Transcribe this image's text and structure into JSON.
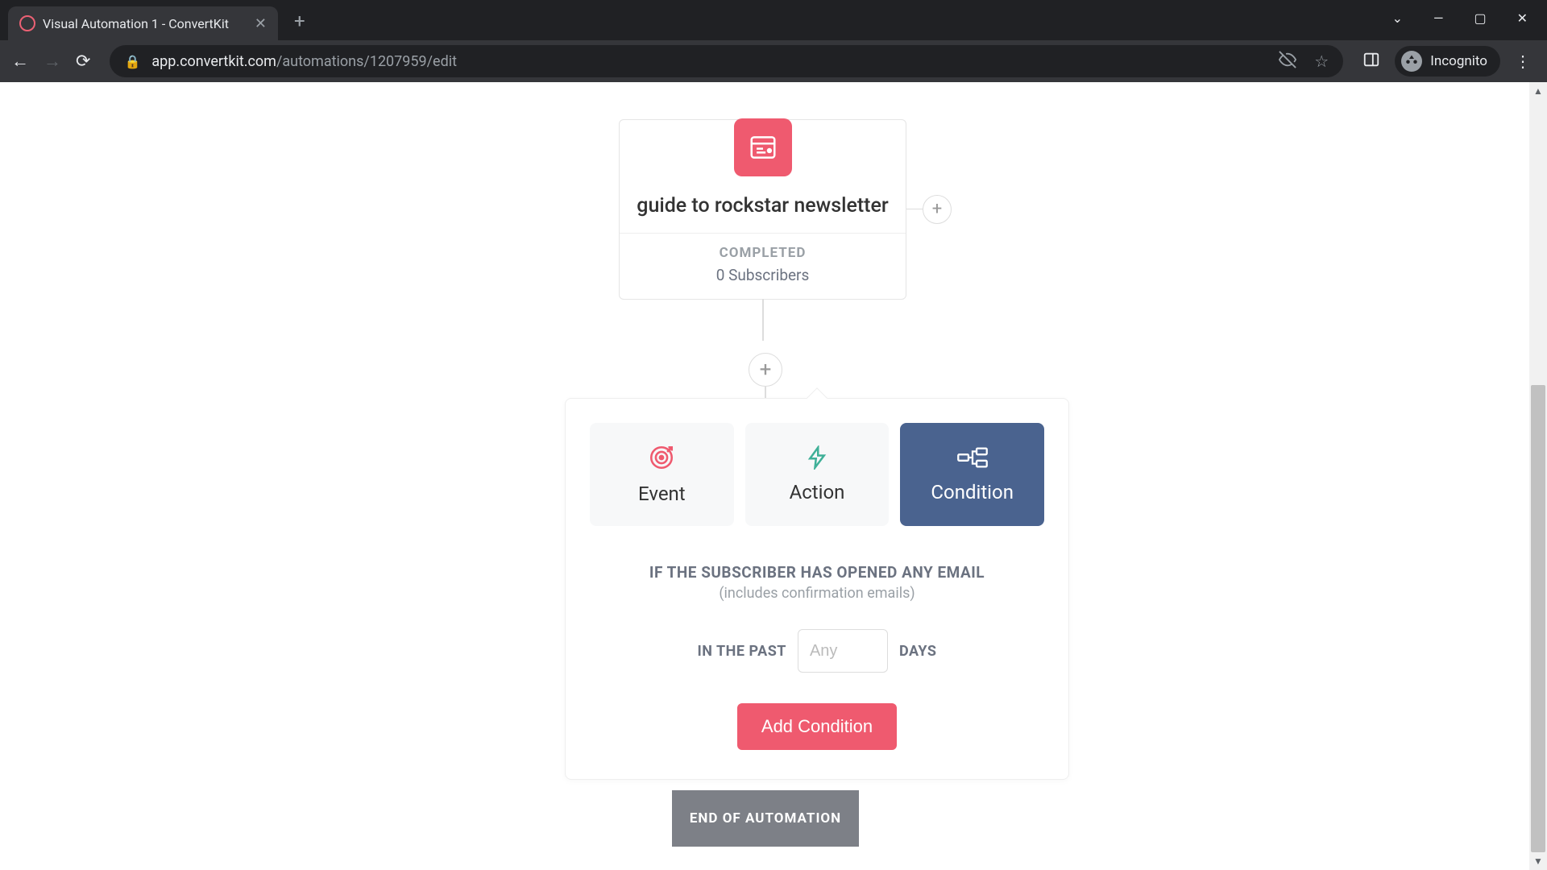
{
  "browser": {
    "tab_title": "Visual Automation 1 - ConvertKit",
    "url_host": "app.convertkit.com",
    "url_path": "/automations/1207959/edit",
    "incognito_label": "Incognito"
  },
  "node": {
    "title": "guide to rockstar newsletter",
    "status": "COMPLETED",
    "subscribers": "0 Subscribers"
  },
  "config": {
    "tabs": {
      "event": "Event",
      "action": "Action",
      "condition": "Condition"
    },
    "heading": "IF THE SUBSCRIBER HAS OPENED ANY EMAIL",
    "subheading": "(includes confirmation emails)",
    "in_past_label": "IN THE PAST",
    "days_label": "DAYS",
    "days_placeholder": "Any",
    "add_button": "Add Condition"
  },
  "end_label": "END OF AUTOMATION"
}
